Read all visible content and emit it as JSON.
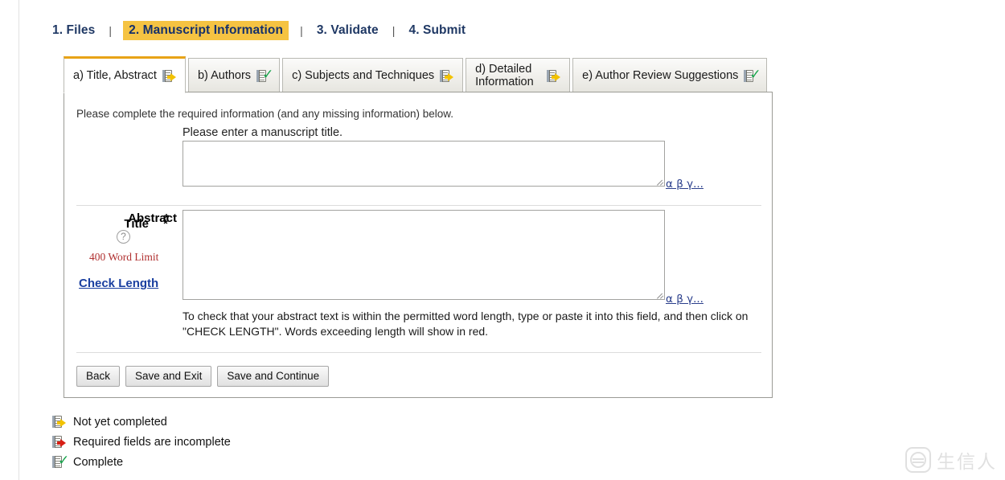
{
  "steps": {
    "separator": "|",
    "items": [
      {
        "label": "1. Files",
        "current": false
      },
      {
        "label": "2. Manuscript Information",
        "current": true
      },
      {
        "label": "3. Validate",
        "current": false
      },
      {
        "label": "4. Submit",
        "current": false
      }
    ]
  },
  "tabs": [
    {
      "label": "a) Title, Abstract",
      "status": "pending",
      "active": true
    },
    {
      "label": "b) Authors",
      "status": "complete",
      "active": false
    },
    {
      "label": "c) Subjects and Techniques",
      "status": "pending",
      "active": false
    },
    {
      "label": "d) Detailed Information",
      "status": "pending",
      "active": false
    },
    {
      "label": "e) Author Review Suggestions",
      "status": "complete",
      "active": false
    }
  ],
  "panel": {
    "intro": "Please complete the required information (and any missing information) below.",
    "title_field": {
      "label": "Title",
      "required_marker": "*",
      "hint": "Please enter a manuscript title.",
      "value": "",
      "special_chars_link": "α β γ..."
    },
    "abstract_field": {
      "label": "Abstract",
      "required_marker": "*",
      "help_icon_label": "?",
      "word_limit": "400 Word Limit",
      "check_length_link": "Check Length",
      "value": "",
      "special_chars_link": "α β γ...",
      "help_text": "To check that your abstract text is within the permitted word length, type or paste it into this field, and then click on \"CHECK LENGTH\". Words exceeding length will show in red."
    },
    "buttons": [
      {
        "label": "Back"
      },
      {
        "label": "Save and Exit"
      },
      {
        "label": "Save and Continue"
      }
    ]
  },
  "legend": [
    {
      "status": "pending",
      "label": "Not yet completed"
    },
    {
      "status": "required",
      "label": "Required fields are incomplete"
    },
    {
      "status": "complete",
      "label": "Complete"
    }
  ],
  "watermark": {
    "text": "生信人"
  },
  "colors": {
    "current_step_bg": "#f5c342",
    "current_step_text": "#15306b",
    "active_tab_top": "#e8a317",
    "link": "#1a3fa0",
    "word_limit": "#b03030",
    "complete": "#16a34a",
    "pending": "#f2c200",
    "required": "#d81f15"
  }
}
